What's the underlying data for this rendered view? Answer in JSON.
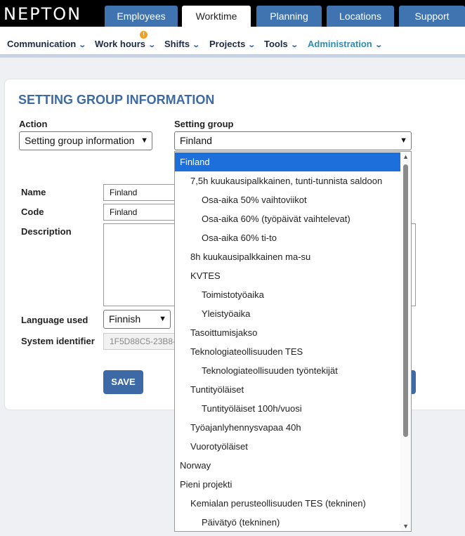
{
  "brand": "NEPTON",
  "tabs": [
    "Employees",
    "Worktime",
    "Planning",
    "Locations",
    "Support"
  ],
  "subnav": {
    "items": [
      "Communication",
      "Work hours",
      "Shifts",
      "Projects",
      "Tools",
      "Administration"
    ],
    "badge": "!"
  },
  "page": {
    "title": "SETTING GROUP INFORMATION",
    "action_label": "Action",
    "action_value": "Setting group information",
    "group_label": "Setting group",
    "group_value": "Finland",
    "name_label": "Name",
    "name_value": "Finland",
    "code_label": "Code",
    "code_value": "Finland",
    "description_label": "Description",
    "language_label": "Language used",
    "language_value": "Finnish",
    "sysid_label": "System identifier",
    "sysid_value": "1F5D88C5-23B8-",
    "save_label": "SAVE"
  },
  "dropdown": {
    "options": [
      "Finland",
      "7,5h kuukausipalkkainen, tunti-tunnista saldoon",
      "Osa-aika 50% vaihtoviikot",
      "Osa-aika 60% (työpäivät vaihtelevat)",
      "Osa-aika 60% ti-to",
      "8h kuukausipalkkainen ma-su",
      "KVTES",
      "Toimistotyöaika",
      "Yleistyöaika",
      "Tasoittumisjakso",
      "Teknologiateollisuuden TES",
      "Teknologiateollisuuden työntekijät",
      "Tuntityöläiset",
      "Tuntityöläiset 100h/vuosi",
      "Työajanlyhennysvapaa 40h",
      "Vuorotyöläiset",
      "Norway",
      "Pieni projekti",
      "Kemialan perusteollisuuden TES (tekninen)",
      "Päivätyö (tekninen)"
    ],
    "selected": "Finland"
  },
  "colors": {
    "accent": "#3f74b0",
    "selected_option": "#1d6fdc",
    "admin_link": "#2e8bb4"
  }
}
